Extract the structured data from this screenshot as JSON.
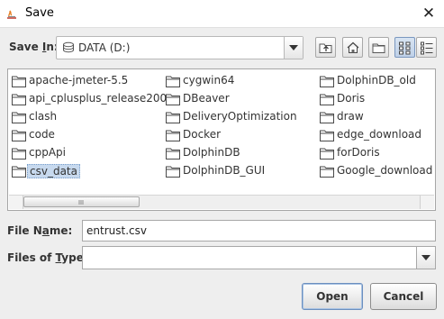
{
  "window": {
    "title": "Save",
    "close_glyph": "✕"
  },
  "save_in": {
    "label_prefix": "Save ",
    "label_mnemonic": "I",
    "label_suffix": "n:",
    "value": "DATA (D:)",
    "icon": "drive-icon"
  },
  "toolbar": {
    "buttons": [
      "up-one-level-icon",
      "home-icon",
      "new-folder-icon",
      "list-view-icon",
      "details-view-icon"
    ],
    "active": "list-view-icon"
  },
  "files": {
    "columns": [
      [
        "apache-jmeter-5.5",
        "api_cplusplus_release200",
        "clash",
        "code",
        "cppApi",
        "csv_data"
      ],
      [
        "cygwin64",
        "DBeaver",
        "DeliveryOptimization",
        "Docker",
        "DolphinDB",
        "DolphinDB_GUI"
      ],
      [
        "DolphinDB_old",
        "Doris",
        "draw",
        "edge_download",
        "forDoris",
        "Google_download"
      ]
    ],
    "selected": "csv_data"
  },
  "file_name": {
    "label_mnemonic": "File N",
    "label_underlined": "a",
    "label_suffix": "me:",
    "value": "entrust.csv"
  },
  "file_type": {
    "label_prefix": "Files of ",
    "label_underlined": "T",
    "label_suffix": "ype:",
    "value": ""
  },
  "buttons": {
    "open": "Open",
    "cancel": "Cancel"
  },
  "colors": {
    "selection": "#c7d9ee",
    "folder": "#4a78b0",
    "background": "#eeeeee"
  }
}
